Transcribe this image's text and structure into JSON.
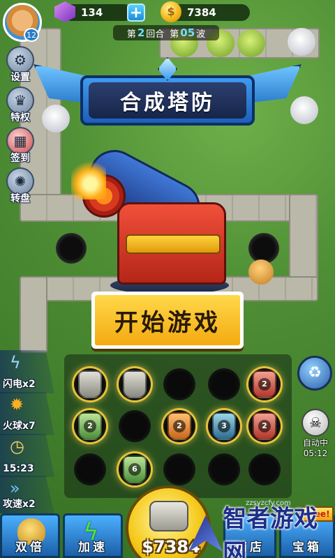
{
  "top_bar": {
    "level": "12",
    "gems": "134",
    "plus": "+",
    "coins": "7384"
  },
  "wave_info": {
    "prefix": "第",
    "round_num": "2",
    "round_label": "回合",
    "wave_prefix": "第",
    "wave_num": "05",
    "wave_label": "波"
  },
  "side_menu": [
    {
      "label": "设置",
      "icon": "gear-icon"
    },
    {
      "label": "特权",
      "icon": "crown-icon"
    },
    {
      "label": "签到",
      "icon": "calendar-icon"
    },
    {
      "label": "转盘",
      "icon": "wheel-icon"
    }
  ],
  "title": "合成塔防",
  "start_button": "开始游戏",
  "skills": [
    {
      "label": "闪电x2",
      "icon": "lightning-icon"
    },
    {
      "label": "火球x7",
      "icon": "fireball-icon"
    },
    {
      "label": "15:23",
      "icon": "clock-icon"
    },
    {
      "label": "攻速x2",
      "icon": "speed-icon"
    }
  ],
  "grid": [
    [
      {
        "tower": "cannon",
        "level": ""
      },
      {
        "tower": "cannon",
        "level": ""
      },
      {
        "tower": "",
        "level": ""
      },
      {
        "tower": "",
        "level": ""
      },
      {
        "tower": "red",
        "level": "2"
      }
    ],
    [
      {
        "tower": "green",
        "level": "2"
      },
      {
        "tower": "",
        "level": ""
      },
      {
        "tower": "orange",
        "level": "2"
      },
      {
        "tower": "blue",
        "level": "3"
      },
      {
        "tower": "red",
        "level": "2"
      }
    ],
    [
      {
        "tower": "",
        "level": ""
      },
      {
        "tower": "green",
        "level": "6"
      },
      {
        "tower": "",
        "level": ""
      },
      {
        "tower": "",
        "level": ""
      },
      {
        "tower": "",
        "level": ""
      }
    ]
  ],
  "auto": {
    "label": "自动中",
    "time": "05:12"
  },
  "bottom_bar": {
    "double_label": "双倍",
    "speed_label": "加速",
    "buy_cost": "$7384",
    "free_tag": "Free!",
    "shop_label": "商店",
    "treasure_label": "宝箱"
  },
  "watermark": {
    "text": "智者游戏网",
    "url": "zzsyzcfy.com"
  },
  "colors": {
    "grass": "#4f8f35",
    "button_yellow": "#ffd84a",
    "banner_blue": "#1e6fc2"
  }
}
